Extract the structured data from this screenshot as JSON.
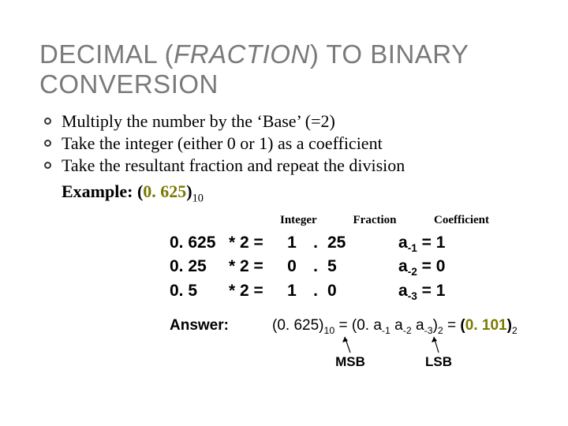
{
  "title": {
    "part1": "DECIMAL (",
    "ital": "FRACTION",
    "part2": ") TO BINARY",
    "line2": "CONVERSION"
  },
  "bullets": [
    "Multiply the number by the ‘Base’ (=2)",
    "Take the integer (either 0 or 1) as a coefficient",
    "Take the resultant fraction and repeat the division"
  ],
  "example": {
    "label": "Example: (",
    "value": "0. 625",
    "close": ")",
    "base": "10"
  },
  "headers": {
    "integer": "Integer",
    "fraction": "Fraction",
    "coefficient": "Coefficient"
  },
  "rows": [
    {
      "num": "0. 625",
      "op": "* 2 =",
      "int": "1",
      "dot": ".",
      "frac": "25",
      "coef_a": "a",
      "coef_sub": "-1",
      "coef_eq": " = 1"
    },
    {
      "num": "0. 25",
      "op": "* 2 =",
      "int": "0",
      "dot": ".",
      "frac": "5",
      "coef_a": "a",
      "coef_sub": "-2",
      "coef_eq": " = 0"
    },
    {
      "num": "0. 5",
      "op": "* 2 =",
      "int": "1",
      "dot": ".",
      "frac": "0",
      "coef_a": "a",
      "coef_sub": "-3",
      "coef_eq": " = 1"
    }
  ],
  "answer": {
    "label": "Answer:",
    "p1": "(0. 625)",
    "b1": "10",
    "p2": " = (0. a",
    "s1": "-1",
    "p3": " a",
    "s2": "-2",
    "p4": " a",
    "s3": "-3",
    "p5": ")",
    "b2": "2",
    "p6": " = ",
    "resOpen": "(",
    "resVal": "0. 101",
    "resClose": ")",
    "resBase": "2"
  },
  "pointers": {
    "msb": "MSB",
    "lsb": "LSB"
  }
}
